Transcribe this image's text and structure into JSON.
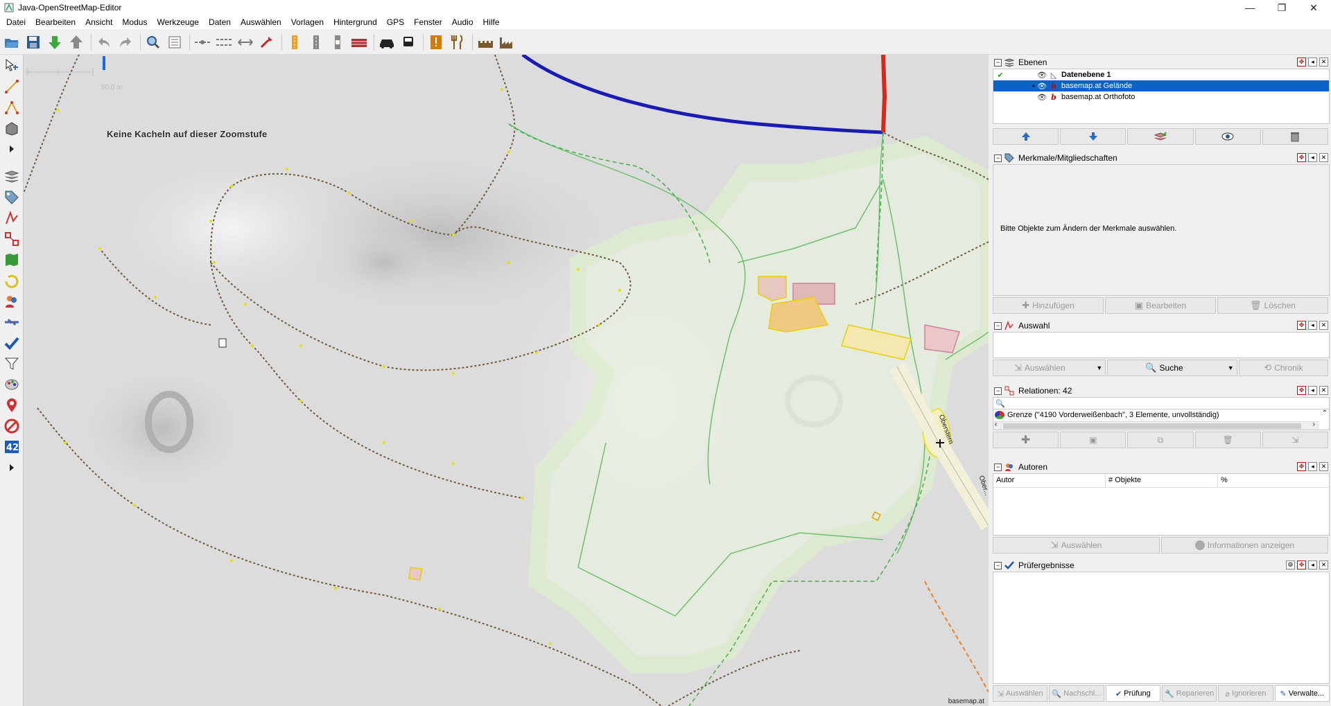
{
  "window": {
    "title": "Java-OpenStreetMap-Editor",
    "controls": [
      "minimize",
      "maximize",
      "close"
    ]
  },
  "menu": [
    "Datei",
    "Bearbeiten",
    "Ansicht",
    "Modus",
    "Werkzeuge",
    "Daten",
    "Auswählen",
    "Vorlagen",
    "Hintergrund",
    "GPS",
    "Fenster",
    "Audio",
    "Hilfe"
  ],
  "toolbar_icons": [
    "open-icon",
    "save-icon",
    "download-icon",
    "upload-icon",
    "undo-icon",
    "redo-icon",
    "zoom-icon",
    "preferences-icon",
    "split-way-icon",
    "combine-way-icon",
    "reverse-way-icon",
    "straight-icon",
    "oneway-icon",
    "lanes-icon",
    "crossing-icon",
    "barrier-icon",
    "car-icon",
    "bus-icon",
    "info-icon",
    "restaurant-icon",
    "castle-icon",
    "factory-icon"
  ],
  "sidebar_icons": [
    "select-icon",
    "draw-icon",
    "improve-way-icon",
    "extrude-icon",
    "more-icon",
    "layers-icon",
    "tags-icon",
    "selection-icon",
    "relations-icon",
    "map-icon",
    "history-icon",
    "authors-icon",
    "conflict-icon",
    "validator-icon",
    "filter-icon",
    "map-paint-icon",
    "notes-icon",
    "changeset-icon",
    "count-icon",
    "more-icon-2"
  ],
  "map": {
    "no_tiles_message": "Keine Kacheln auf dieser Zoomstufe",
    "scale_label": "50.0 m",
    "attribution": "basemap.at",
    "road_label_1": "Oberstern",
    "road_label_2": "Ober..."
  },
  "colors": {
    "selected_row": "#0a64c8",
    "road_blue": "#1a1ab4",
    "road_red": "#d42a1a",
    "boundary": "#6e5a3a",
    "path_green": "#6cc06c"
  },
  "layers_panel": {
    "title": "Ebenen",
    "layers": [
      {
        "name": "Datenebene 1",
        "bold": true,
        "active": true,
        "selected": false
      },
      {
        "name": "basemap.at Gelände",
        "bold": false,
        "active": false,
        "selected": true
      },
      {
        "name": "basemap.at Orthofoto",
        "bold": false,
        "active": false,
        "selected": false
      }
    ],
    "buttons": [
      "move-up-icon",
      "move-down-icon",
      "merge-icon",
      "visibility-icon",
      "delete-icon"
    ]
  },
  "tags_panel": {
    "title": "Merkmale/Mitgliedschaften",
    "message": "Bitte Objekte zum Ändern der Merkmale auswählen.",
    "buttons": [
      "Hinzufügen",
      "Bearbeiten",
      "Löschen"
    ]
  },
  "selection_panel": {
    "title": "Auswahl",
    "buttons": [
      "Auswählen",
      "Suche",
      "Chronik"
    ]
  },
  "relations_panel": {
    "title": "Relationen: 42",
    "search_placeholder": "",
    "items": [
      "Grenze (\"4190 Vorderweißenbach\", 3 Elemente, unvollständig)"
    ]
  },
  "authors_panel": {
    "title": "Autoren",
    "columns": [
      "Autor",
      "# Objekte",
      "%"
    ],
    "buttons": [
      "Auswählen",
      "Informationen anzeigen"
    ]
  },
  "validation_panel": {
    "title": "Prüfergebnisse"
  },
  "bottom_tabs": [
    "Auswählen",
    "Nachschl...",
    "Prüfung",
    "Reparieren",
    "Ignorieren",
    "Verwalte..."
  ]
}
